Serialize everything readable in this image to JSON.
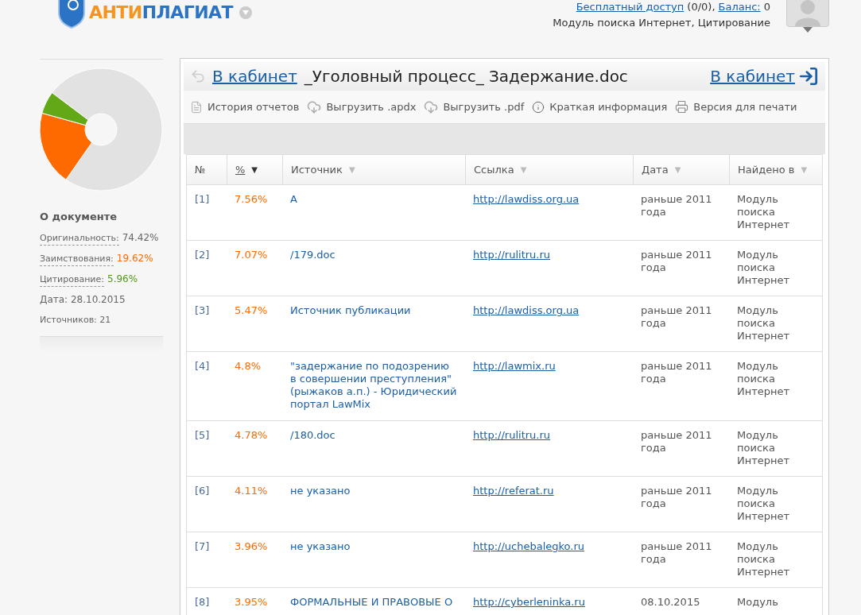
{
  "header": {
    "logo": {
      "part_1": "АНТИ",
      "part_2": "ПЛАГИАТ"
    },
    "account": {
      "free_access_link": "Бесплатный доступ",
      "free_access_count": "(0/0),",
      "balance_link": "Баланс:",
      "balance_value": "0",
      "modules": "Модуль поиска Интернет, Цитирование"
    }
  },
  "sidebar": {
    "chart_data": {
      "type": "donut",
      "values": [
        74.42,
        19.62,
        5.96
      ],
      "colors": [
        "#e2e2e2",
        "#ff6a00",
        "#62a817"
      ]
    },
    "title": "О документе",
    "stats": [
      {
        "kind": "metric",
        "label": "Оригинальность:",
        "value": "74.42%",
        "color": "#666666"
      },
      {
        "kind": "metric",
        "label": "Заимствования:",
        "value": "19.62%",
        "color": "#ff6a00"
      },
      {
        "kind": "metric",
        "label": "Цитирование:",
        "value": "5.96%",
        "color": "#4f9a12"
      },
      {
        "kind": "plain",
        "text": "Дата: 28.10.2015"
      },
      {
        "kind": "plain",
        "text": "Источников: 21"
      }
    ]
  },
  "report": {
    "back_link": "В кабинет",
    "document_title": "_Уголовный процесс_ Задержание.doc",
    "cabinet_link": "В кабинет",
    "toolbar": [
      {
        "kind": "document",
        "label": "История отчетов"
      },
      {
        "kind": "download",
        "label": "Выгрузить .apdx"
      },
      {
        "kind": "download",
        "label": "Выгрузить .pdf"
      },
      {
        "kind": "info",
        "label": "Краткая информация"
      },
      {
        "kind": "print",
        "label": "Версия для печати"
      }
    ],
    "table": {
      "columns": [
        {
          "label": "№",
          "sorted": false
        },
        {
          "label": "%",
          "sort_arrow": "▼",
          "sorted": true
        },
        {
          "label": "Источник",
          "sort_arrow": "▼",
          "sorted": false
        },
        {
          "label": "Ссылка",
          "sort_arrow": "▼",
          "sorted": false
        },
        {
          "label": "Дата",
          "sort_arrow": "▼",
          "sorted": false
        },
        {
          "label": "Найдено в",
          "sort_arrow": "▼",
          "sorted": false
        }
      ],
      "rows": [
        {
          "number": "[1]",
          "percent": "7.56%",
          "source": "А",
          "link": "http://lawdiss.org.ua",
          "date": "раньше 2011 года",
          "found_in": "Модуль поиска Интернет"
        },
        {
          "number": "[2]",
          "percent": "7.07%",
          "source": "/179.doc",
          "link": "http://rulitru.ru",
          "date": "раньше 2011 года",
          "found_in": "Модуль поиска Интернет"
        },
        {
          "number": "[3]",
          "percent": "5.47%",
          "source": "Источник публикации",
          "link": "http://lawdiss.org.ua",
          "date": "раньше 2011 года",
          "found_in": "Модуль поиска Интернет"
        },
        {
          "number": "[4]",
          "percent": "4.8%",
          "source": "\"задержание по подозрению в совершении преступления\" (рыжаков а.п.) - Юридический портал LawMix",
          "link": "http://lawmix.ru",
          "date": "раньше 2011 года",
          "found_in": "Модуль поиска Интернет"
        },
        {
          "number": "[5]",
          "percent": "4.78%",
          "source": "/180.doc",
          "link": "http://rulitru.ru",
          "date": "раньше 2011 года",
          "found_in": "Модуль поиска Интернет"
        },
        {
          "number": "[6]",
          "percent": "4.11%",
          "source": "не указано",
          "link": "http://referat.ru",
          "date": "раньше 2011 года",
          "found_in": "Модуль поиска Интернет"
        },
        {
          "number": "[7]",
          "percent": "3.96%",
          "source": "не указано",
          "link": "http://uchebalegko.ru",
          "date": "раньше 2011 года",
          "found_in": "Модуль поиска Интернет"
        },
        {
          "number": "[8]",
          "percent": "3.95%",
          "source": "ФОРМАЛЬНЫЕ И ПРАВОВЫЕ О",
          "link": "http://cyberleninka.ru",
          "date": "08.10.2015",
          "found_in": "Модуль"
        }
      ]
    }
  }
}
